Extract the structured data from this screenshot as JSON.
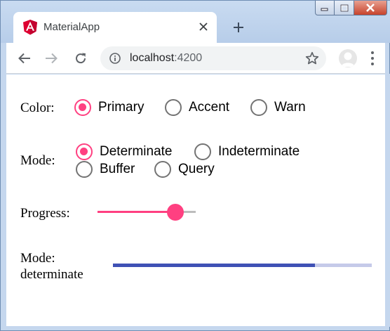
{
  "browser": {
    "tab": {
      "title": "MaterialApp",
      "favicon": "angular-icon"
    },
    "url": {
      "host": "localhost",
      "port": ":4200"
    },
    "icons": {
      "back": "arrow-back-icon",
      "forward": "arrow-forward-icon",
      "reload": "reload-icon",
      "info": "info-icon",
      "bookmark": "star-icon",
      "profile": "profile-icon",
      "menu": "more-vert-icon",
      "new_tab": "plus-icon"
    }
  },
  "form": {
    "color": {
      "label": "Color:",
      "options": [
        "Primary",
        "Accent",
        "Warn"
      ],
      "selected": "Primary"
    },
    "mode": {
      "label": "Mode:",
      "options": [
        "Determinate",
        "Indeterminate",
        "Buffer",
        "Query"
      ],
      "selected": "Determinate"
    },
    "progress": {
      "label": "Progress:",
      "value": 0.79
    },
    "bar": {
      "label_line1": "Mode:",
      "label_line2": "determinate",
      "value": 0.78
    }
  },
  "colors": {
    "accent": "#ff4081",
    "primary": "#3f51b5",
    "primary_light": "#c5cae9",
    "frame": "#c5d7ee"
  }
}
